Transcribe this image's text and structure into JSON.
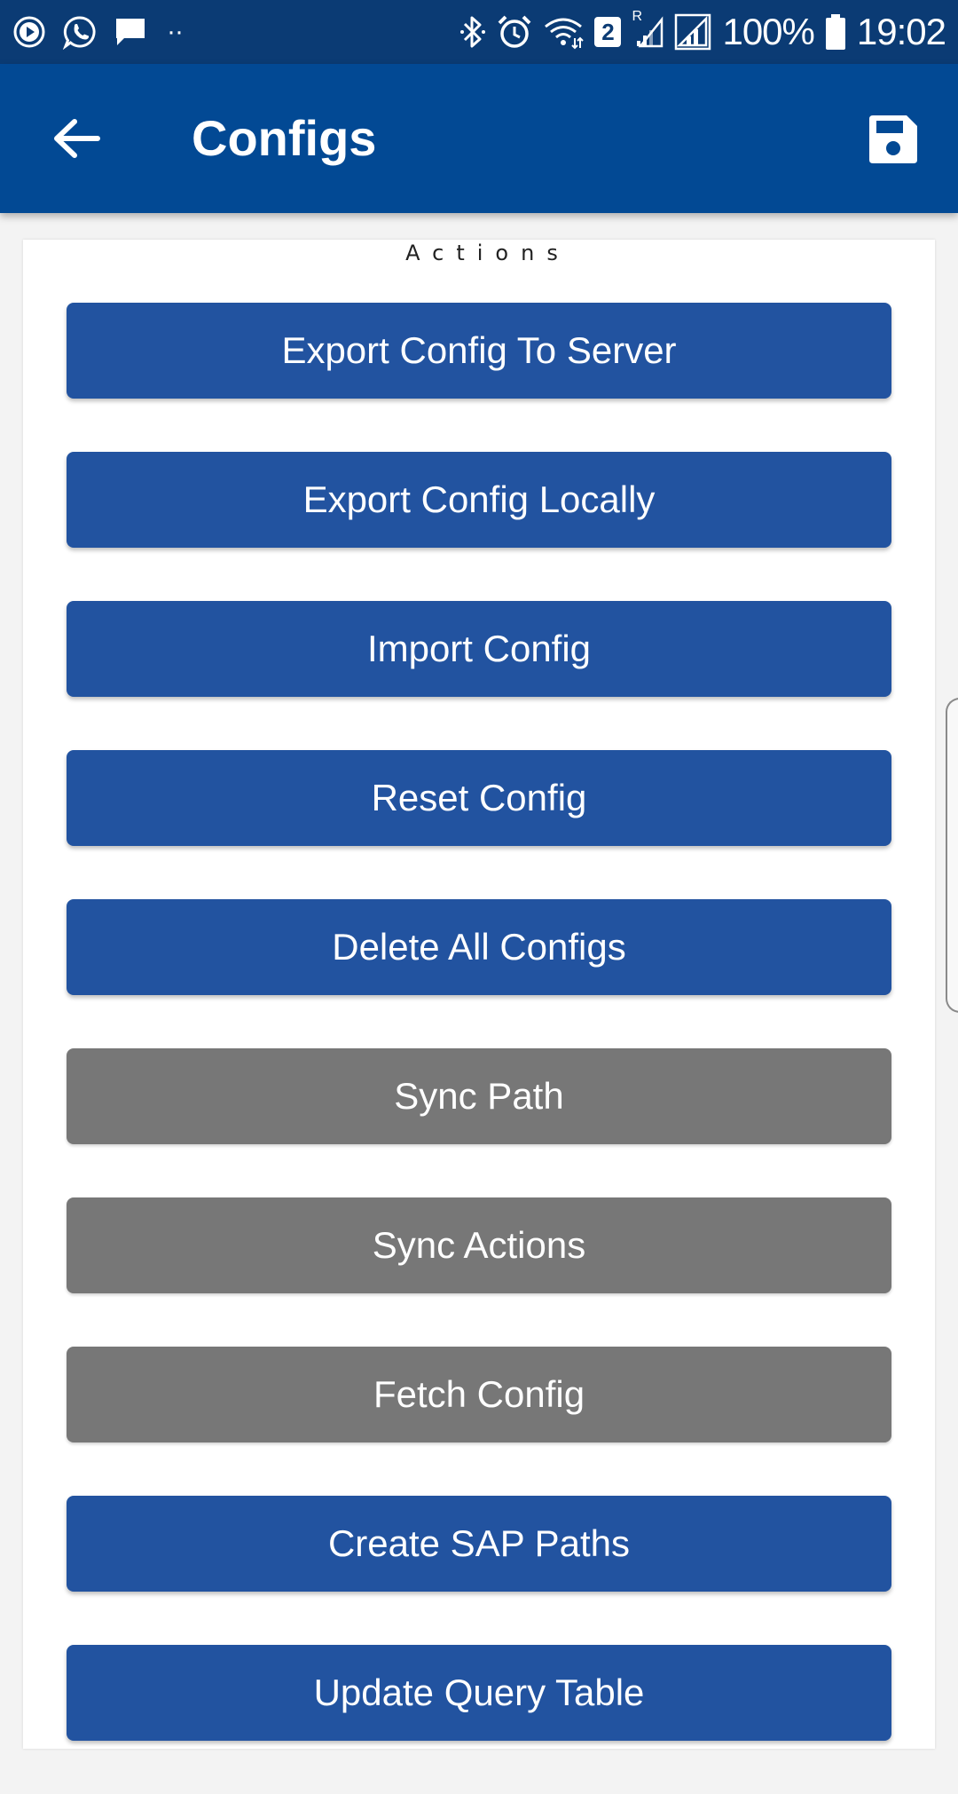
{
  "status_bar": {
    "battery_percent": "100%",
    "time": "19:02",
    "sim_number": "2",
    "roaming_flag": "R",
    "more_dots": "··",
    "icons": [
      "media-play-icon",
      "whatsapp-icon",
      "message-icon",
      "bluetooth-icon",
      "alarm-icon",
      "wifi-icon",
      "sim-icon",
      "signal-icon",
      "signal-full-icon",
      "battery-icon"
    ]
  },
  "app_bar": {
    "title": "Configs",
    "back_icon": "arrow-left-icon",
    "save_icon": "floppy-disk-icon"
  },
  "section": {
    "heading": "Actions"
  },
  "actions": [
    {
      "label": "Export Config To Server",
      "state": "enabled"
    },
    {
      "label": "Export Config Locally",
      "state": "enabled"
    },
    {
      "label": "Import Config",
      "state": "enabled"
    },
    {
      "label": "Reset Config",
      "state": "enabled"
    },
    {
      "label": "Delete All Configs",
      "state": "enabled"
    },
    {
      "label": "Sync Path",
      "state": "disabled"
    },
    {
      "label": "Sync Actions",
      "state": "disabled"
    },
    {
      "label": "Fetch Config",
      "state": "disabled"
    },
    {
      "label": "Create SAP Paths",
      "state": "enabled"
    },
    {
      "label": "Update Query Table",
      "state": "enabled"
    }
  ],
  "colors": {
    "status_bar": "#0b3b74",
    "app_bar": "#024994",
    "button_primary": "#2253a0",
    "button_disabled": "#777777",
    "background": "#f3f3f3"
  }
}
